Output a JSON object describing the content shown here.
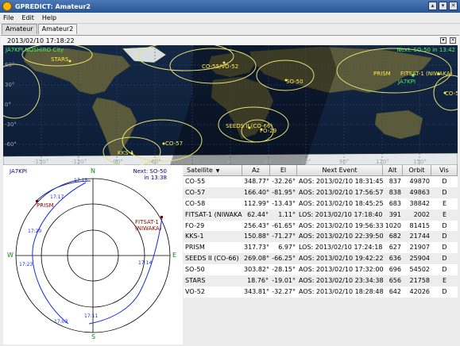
{
  "window": {
    "title": "GPREDICT: Amateur2",
    "buttons": [
      "▴",
      "▾",
      "✕"
    ]
  },
  "menu": {
    "items": [
      "File",
      "Edit",
      "Help"
    ],
    "mnemonics": [
      "F",
      "E",
      "H"
    ]
  },
  "tabs": [
    "Amateur",
    "Amateur2"
  ],
  "module": {
    "clock": "2013/02/10 17:18:22"
  },
  "map": {
    "qth_label": "JA7KPI   NOSHIRO City",
    "next_label": "Next: SO-50 in 13:42",
    "lat_ticks": [
      "60°",
      "30°",
      "0°",
      "-30°",
      "-60°"
    ],
    "lon_ticks": [
      "-150°",
      "-120°",
      "-90°",
      "-60°",
      "-30°",
      "0°",
      "30°",
      "60°",
      "90°",
      "120°",
      "150°"
    ],
    "sat_labels": [
      "STARS",
      "CO-55/VO-52",
      "SO-50",
      "PRISM",
      "FITSAT-1 (NIWAKA)",
      "JA7KPI",
      "CO-58",
      "SEEDS II (CO-66)",
      "FO-29",
      "CO-57",
      "KKS-1"
    ]
  },
  "polar": {
    "qth": "JA7KPI",
    "next_line1": "Next: SO-50",
    "next_line2": "in 13:38",
    "compass": [
      "N",
      "E",
      "S",
      "W"
    ],
    "sat_labels": [
      "PRISM",
      "FITSAT-1 (NIWAKA)"
    ],
    "time_labels": [
      "17:15",
      "17:17",
      "17:20",
      "17:23",
      "17:03",
      "17:11",
      "17:14"
    ]
  },
  "table": {
    "headers": [
      "Satellite",
      "Az",
      "El",
      "Next Event",
      "Alt",
      "Orbit",
      "Vis"
    ],
    "rows": [
      [
        "CO-55",
        "348.77°",
        "-32.26°",
        "AOS: 2013/02/10 18:31:45",
        "837",
        "49870",
        "D"
      ],
      [
        "CO-57",
        "166.40°",
        "-81.95°",
        "AOS: 2013/02/10 17:56:57",
        "838",
        "49863",
        "D"
      ],
      [
        "CO-58",
        "112.99°",
        "-13.43°",
        "AOS: 2013/02/10 18:45:25",
        "683",
        "38842",
        "E"
      ],
      [
        "FITSAT-1 (NIWAKA)",
        "62.44°",
        "1.11°",
        "LOS: 2013/02/10 17:18:40",
        "391",
        "2002",
        "E"
      ],
      [
        "FO-29",
        "256.43°",
        "-61.65°",
        "AOS: 2013/02/10 19:56:33",
        "1020",
        "81415",
        "D"
      ],
      [
        "KKS-1",
        "150.88°",
        "-71.27°",
        "AOS: 2013/02/10 22:39:50",
        "682",
        "21744",
        "D"
      ],
      [
        "PRISM",
        "317.73°",
        "6.97°",
        "LOS: 2013/02/10 17:24:18",
        "627",
        "21907",
        "D"
      ],
      [
        "SEEDS II (CO-66)",
        "269.08°",
        "-66.25°",
        "AOS: 2013/02/10 19:42:22",
        "636",
        "25904",
        "D"
      ],
      [
        "SO-50",
        "303.82°",
        "-28.15°",
        "AOS: 2013/02/10 17:32:00",
        "696",
        "54502",
        "D"
      ],
      [
        "STARS",
        "18.76°",
        "-19.01°",
        "AOS: 2013/02/10 23:34:38",
        "656",
        "21758",
        "E"
      ],
      [
        "VO-52",
        "343.81°",
        "-32.27°",
        "AOS: 2013/02/10 18:28:48",
        "642",
        "42026",
        "D"
      ]
    ]
  },
  "colors": {
    "footprint": "#e8e070",
    "sat_dot": "#ffe94a",
    "qth": "#5ef05e",
    "polar_track": "#1a2ee0",
    "polar_sat": "#8b0000"
  }
}
